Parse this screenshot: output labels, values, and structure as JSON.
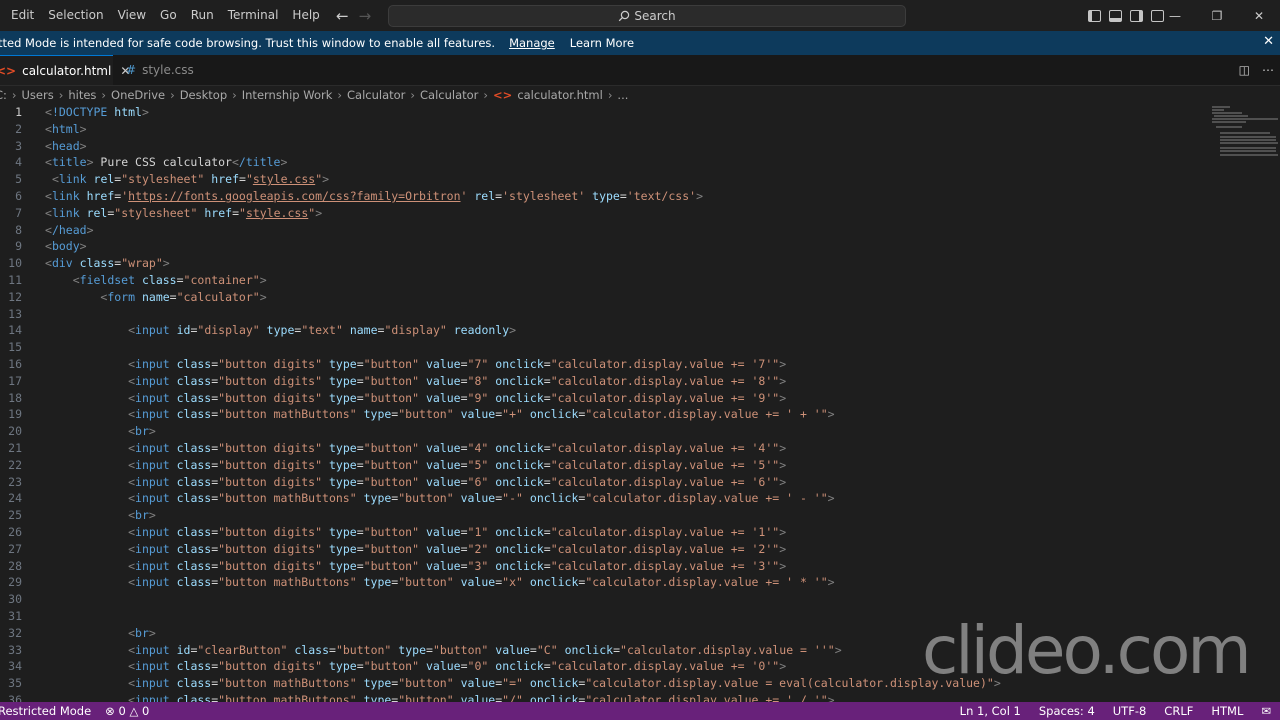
{
  "menu": [
    "Edit",
    "Selection",
    "View",
    "Go",
    "Run",
    "Terminal",
    "Help"
  ],
  "search": {
    "icon": "search-icon",
    "label": "Search"
  },
  "banner": {
    "message": "tted Mode is intended for safe code browsing. Trust this window to enable all features.",
    "manage": "Manage",
    "learn_more": "Learn More"
  },
  "tabs": [
    {
      "label": "calculator.html",
      "icon": "html-file-icon"
    },
    {
      "label": "style.css",
      "icon": "hash-icon"
    }
  ],
  "breadcrumb": [
    "C:",
    "Users",
    "hites",
    "OneDrive",
    "Desktop",
    "Internship Work",
    "Calculator",
    "Calculator",
    "calculator.html",
    "..."
  ],
  "editor": {
    "lines": [
      "<!DOCTYPE html>",
      "<html>",
      "<head>",
      "<title> Pure CSS calculator</title>",
      " <link rel=\"stylesheet\" href=\"style.css\">",
      "<link href='https://fonts.googleapis.com/css?family=Orbitron' rel='stylesheet' type='text/css'>",
      "<link rel=\"stylesheet\" href=\"style.css\">",
      "</head>",
      "<body>",
      "<div class=\"wrap\">",
      "    <fieldset class=\"container\">",
      "        <form name=\"calculator\">",
      "",
      "            <input id=\"display\" type=\"text\" name=\"display\" readonly>",
      "",
      "            <input class=\"button digits\" type=\"button\" value=\"7\" onclick=\"calculator.display.value += '7'\">",
      "            <input class=\"button digits\" type=\"button\" value=\"8\" onclick=\"calculator.display.value += '8'\">",
      "            <input class=\"button digits\" type=\"button\" value=\"9\" onclick=\"calculator.display.value += '9'\">",
      "            <input class=\"button mathButtons\" type=\"button\" value=\"+\" onclick=\"calculator.display.value += ' + '\">",
      "            <br>",
      "            <input class=\"button digits\" type=\"button\" value=\"4\" onclick=\"calculator.display.value += '4'\">",
      "            <input class=\"button digits\" type=\"button\" value=\"5\" onclick=\"calculator.display.value += '5'\">",
      "            <input class=\"button digits\" type=\"button\" value=\"6\" onclick=\"calculator.display.value += '6'\">",
      "            <input class=\"button mathButtons\" type=\"button\" value=\"-\" onclick=\"calculator.display.value += ' - '\">",
      "            <br>",
      "            <input class=\"button digits\" type=\"button\" value=\"1\" onclick=\"calculator.display.value += '1'\">",
      "            <input class=\"button digits\" type=\"button\" value=\"2\" onclick=\"calculator.display.value += '2'\">",
      "            <input class=\"button digits\" type=\"button\" value=\"3\" onclick=\"calculator.display.value += '3'\">",
      "            <input class=\"button mathButtons\" type=\"button\" value=\"x\" onclick=\"calculator.display.value += ' * '\">",
      "",
      "",
      "            <br>",
      "            <input id=\"clearButton\" class=\"button\" type=\"button\" value=\"C\" onclick=\"calculator.display.value = ''\">",
      "            <input class=\"button digits\" type=\"button\" value=\"0\" onclick=\"calculator.display.value += '0'\">",
      "            <input class=\"button mathButtons\" type=\"button\" value=\"=\" onclick=\"calculator.display.value = eval(calculator.display.value)\">",
      "            <input class=\"button mathButtons\" type=\"button\" value=\"/\" onclick=\"calculator.display.value += ' / '\">"
    ],
    "current_line": 1
  },
  "watermark": "clideo.com",
  "status": {
    "restricted": "Restricted Mode",
    "errors": "0",
    "warnings": "0",
    "position": "Ln 1, Col 1",
    "spaces": "Spaces: 4",
    "encoding": "UTF-8",
    "eol": "CRLF",
    "language": "HTML"
  },
  "colors": {
    "status_bar": "#68217a",
    "banner": "#0d3a5c",
    "accent": "#0078d4"
  }
}
